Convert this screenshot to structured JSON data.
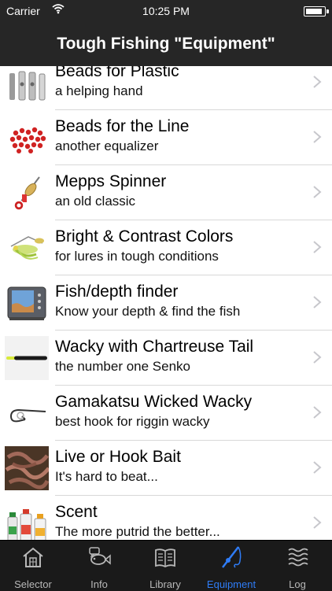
{
  "status_bar": {
    "carrier": "Carrier",
    "time": "10:25 PM"
  },
  "nav": {
    "title": "Tough Fishing \"Equipment\""
  },
  "items": [
    {
      "title": "Beads for Plastic",
      "subtitle": "a helping hand",
      "icon": "bead-pegs-icon"
    },
    {
      "title": "Beads for the Line",
      "subtitle": "another equalizer",
      "icon": "red-beads-icon"
    },
    {
      "title": "Mepps Spinner",
      "subtitle": "an old classic",
      "icon": "spinner-lure-icon"
    },
    {
      "title": "Bright & Contrast Colors",
      "subtitle": "for lures in tough conditions",
      "icon": "spinnerbait-icon"
    },
    {
      "title": "Fish/depth finder",
      "subtitle": "Know your depth & find the fish",
      "icon": "depth-finder-icon"
    },
    {
      "title": "Wacky with Chartreuse Tail",
      "subtitle": "the number one Senko",
      "icon": "senko-worm-icon"
    },
    {
      "title": "Gamakatsu Wicked Wacky",
      "subtitle": "best hook for riggin wacky",
      "icon": "wacky-hook-icon"
    },
    {
      "title": "Live or Hook Bait",
      "subtitle": "It's hard to beat...",
      "icon": "live-worms-icon"
    },
    {
      "title": "Scent",
      "subtitle": "The more putrid the better...",
      "icon": "scent-bottles-icon"
    }
  ],
  "tabs": [
    {
      "label": "Selector",
      "icon": "house-icon"
    },
    {
      "label": "Info",
      "icon": "fish-info-icon"
    },
    {
      "label": "Library",
      "icon": "book-icon"
    },
    {
      "label": "Equipment",
      "icon": "fishing-rod-icon",
      "active": true
    },
    {
      "label": "Log",
      "icon": "log-waves-icon"
    }
  ],
  "colors": {
    "bar_bg": "#262626",
    "tab_bg": "#1a1a1a",
    "active_tab": "#2f7cf6",
    "inactive_tab": "#b8b8b8"
  }
}
